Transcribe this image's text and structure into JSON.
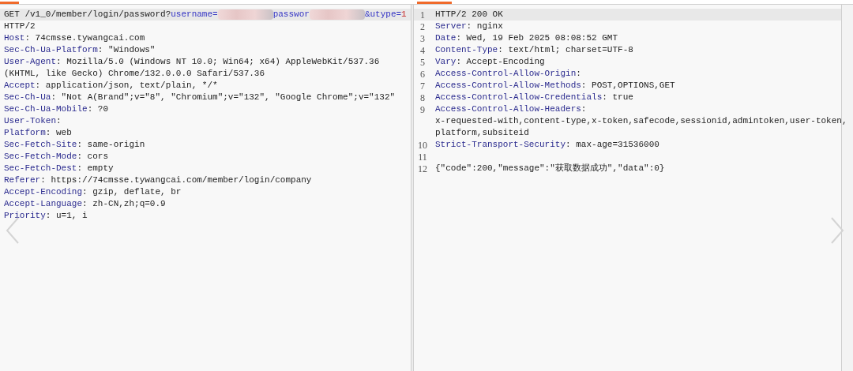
{
  "request_pane": {
    "rows": [
      {
        "kind": "request_line",
        "selected": true,
        "segments": [
          {
            "kind": "plain",
            "text": "GET /v1_0/member/login/password?"
          },
          {
            "kind": "param",
            "text": "username="
          },
          {
            "kind": "redacted"
          },
          {
            "kind": "param",
            "text": "passwor"
          },
          {
            "kind": "redacted"
          },
          {
            "kind": "param",
            "text": "&utype="
          },
          {
            "kind": "number",
            "text": "1"
          }
        ]
      },
      {
        "kind": "text",
        "selected": false,
        "text": "HTTP/2"
      },
      {
        "kind": "header",
        "selected": false,
        "key": "Host",
        "value": ": 74cmsse.tywangcai.com"
      },
      {
        "kind": "header",
        "selected": false,
        "key": "Sec-Ch-Ua-Platform",
        "value": ": \"Windows\""
      },
      {
        "kind": "header",
        "selected": false,
        "key": "User-Agent",
        "value": ": Mozilla/5.0 (Windows NT 10.0; Win64; x64) AppleWebKit/537.36"
      },
      {
        "kind": "text",
        "selected": false,
        "text": "(KHTML, like Gecko) Chrome/132.0.0.0 Safari/537.36"
      },
      {
        "kind": "header",
        "selected": false,
        "key": "Accept",
        "value": ": application/json, text/plain, */*"
      },
      {
        "kind": "header",
        "selected": false,
        "key": "Sec-Ch-Ua",
        "value": ": \"Not A(Brand\";v=\"8\", \"Chromium\";v=\"132\", \"Google Chrome\";v=\"132\""
      },
      {
        "kind": "header",
        "selected": false,
        "key": "Sec-Ch-Ua-Mobile",
        "value": ": ?0"
      },
      {
        "kind": "header",
        "selected": false,
        "key": "User-Token",
        "value": ":"
      },
      {
        "kind": "header",
        "selected": false,
        "key": "Platform",
        "value": ": web"
      },
      {
        "kind": "header",
        "selected": false,
        "key": "Sec-Fetch-Site",
        "value": ": same-origin"
      },
      {
        "kind": "header",
        "selected": false,
        "key": "Sec-Fetch-Mode",
        "value": ": cors"
      },
      {
        "kind": "header",
        "selected": false,
        "key": "Sec-Fetch-Dest",
        "value": ": empty"
      },
      {
        "kind": "header",
        "selected": false,
        "key": "Referer",
        "value": ": https://74cmsse.tywangcai.com/member/login/company"
      },
      {
        "kind": "header",
        "selected": false,
        "key": "Accept-Encoding",
        "value": ": gzip, deflate, br"
      },
      {
        "kind": "header",
        "selected": false,
        "key": "Accept-Language",
        "value": ": zh-CN,zh;q=0.9"
      },
      {
        "kind": "header",
        "selected": false,
        "key": "Priority",
        "value": ": u=1, i"
      }
    ]
  },
  "response_pane": {
    "rows": [
      {
        "number": "1",
        "kind": "text",
        "selected": true,
        "text": "HTTP/2 200 OK"
      },
      {
        "number": "2",
        "kind": "header",
        "selected": false,
        "key": "Server",
        "value": ": nginx"
      },
      {
        "number": "3",
        "kind": "header",
        "selected": false,
        "key": "Date",
        "value": ": Wed, 19 Feb 2025 08:08:52 GMT"
      },
      {
        "number": "4",
        "kind": "header",
        "selected": false,
        "key": "Content-Type",
        "value": ": text/html; charset=UTF-8"
      },
      {
        "number": "5",
        "kind": "header",
        "selected": false,
        "key": "Vary",
        "value": ": Accept-Encoding"
      },
      {
        "number": "6",
        "kind": "header",
        "selected": false,
        "key": "Access-Control-Allow-Origin",
        "value": ":"
      },
      {
        "number": "7",
        "kind": "header",
        "selected": false,
        "key": "Access-Control-Allow-Methods",
        "value": ": POST,OPTIONS,GET"
      },
      {
        "number": "8",
        "kind": "header",
        "selected": false,
        "key": "Access-Control-Allow-Credentials",
        "value": ": true"
      },
      {
        "number": "9",
        "kind": "header",
        "selected": false,
        "key": "Access-Control-Allow-Headers",
        "value": ":"
      },
      {
        "kind": "text",
        "selected": false,
        "text": "x-requested-with,content-type,x-token,safecode,sessionid,admintoken,user-token,"
      },
      {
        "kind": "text",
        "selected": false,
        "text": "platform,subsiteid"
      },
      {
        "number": "10",
        "kind": "header",
        "selected": false,
        "key": "Strict-Transport-Security",
        "value": ": max-age=31536000"
      },
      {
        "number": "11",
        "kind": "empty",
        "selected": false
      },
      {
        "number": "12",
        "kind": "text",
        "selected": false,
        "text": "{\"code\":200,\"message\":\"获取数据成功\",\"data\":0}"
      }
    ]
  }
}
